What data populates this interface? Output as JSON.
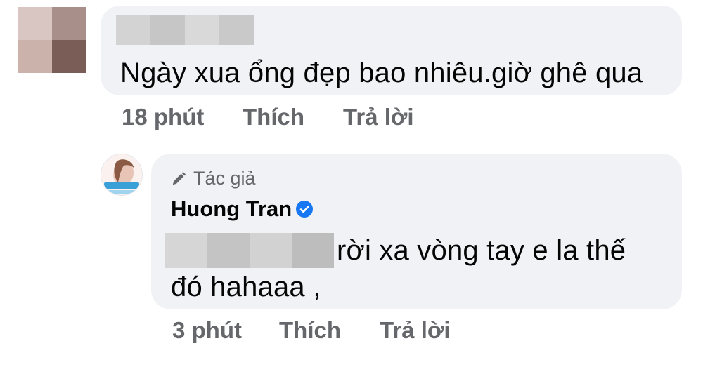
{
  "comment1": {
    "text": "Ngày xua ổng đẹp bao nhiêu.giờ ghê qua",
    "time": "18 phút",
    "like_label": "Thích",
    "reply_label": "Trả lời"
  },
  "reply": {
    "author_badge": "Tác giả",
    "author_name": "Huong Tran",
    "text_line1": "rời xa vòng tay e la thế",
    "text_line2": "đó hahaaa ,",
    "time": "3 phút",
    "like_label": "Thích",
    "reply_label": "Trả lời"
  },
  "colors": {
    "bubble": "#f0f2f5",
    "meta_text": "#65676b",
    "verified": "#1877f2"
  },
  "icons": [
    "pencil-icon",
    "verified-badge-icon"
  ]
}
